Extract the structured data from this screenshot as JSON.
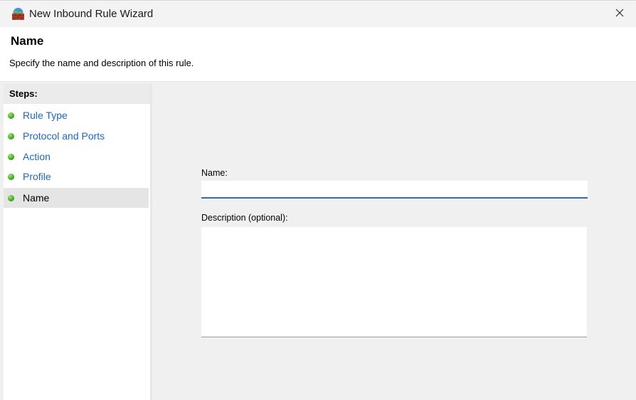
{
  "window": {
    "title": "New Inbound Rule Wizard",
    "icon": "firewall-icon",
    "close_icon": "close-icon"
  },
  "header": {
    "title": "Name",
    "subtitle": "Specify the name and description of this rule."
  },
  "steps": {
    "label": "Steps:",
    "items": [
      {
        "label": "Rule Type",
        "active": false
      },
      {
        "label": "Protocol and Ports",
        "active": false
      },
      {
        "label": "Action",
        "active": false
      },
      {
        "label": "Profile",
        "active": false
      },
      {
        "label": "Name",
        "active": true
      }
    ],
    "link_color": "#1f66c1",
    "dot_color": "#46b11e"
  },
  "form": {
    "name_label": "Name:",
    "name_value": "",
    "description_label": "Description (optional):",
    "description_value": "",
    "focus_accent": "#2b6cc9"
  }
}
